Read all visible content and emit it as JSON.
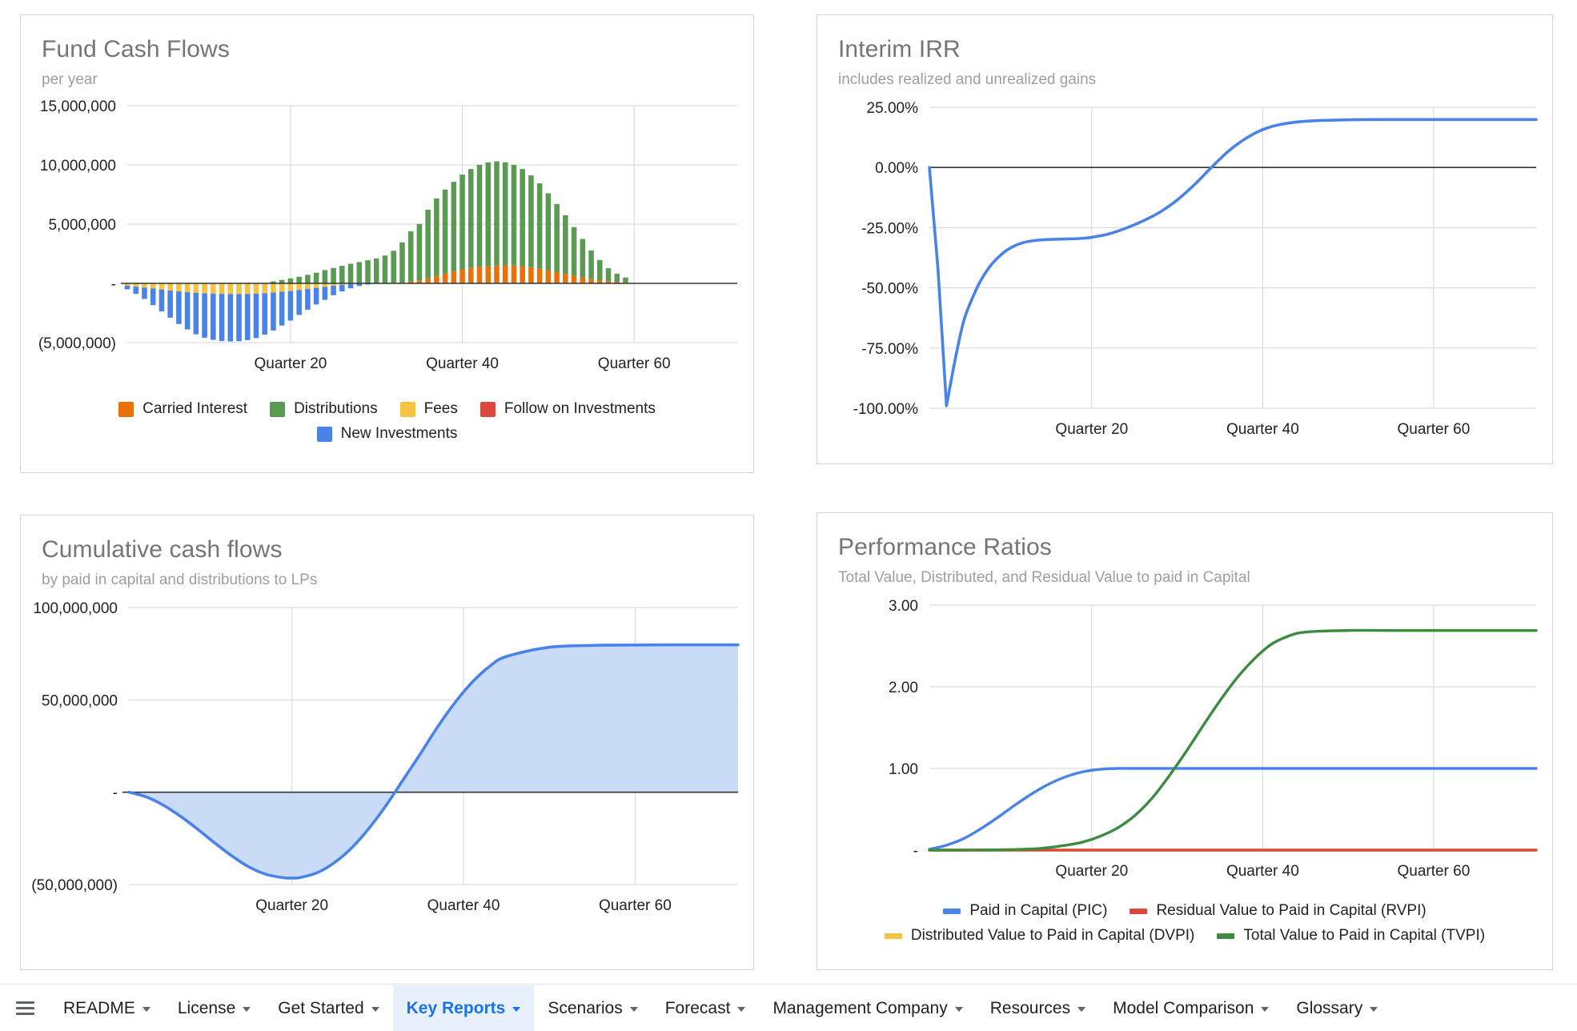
{
  "charts": [
    {
      "id": "fund-cash-flows",
      "title": "Fund Cash Flows",
      "subtitle": "per year",
      "chart_data": {
        "type": "bar",
        "title": "Fund Cash Flows",
        "subtitle": "per year",
        "stacked": true,
        "xlabel": "",
        "ylabel": "",
        "ylim": [
          -5000000,
          15000000
        ],
        "ytick_labels": [
          "15,000,000",
          "10,000,000",
          "5,000,000",
          "-",
          "(5,000,000)"
        ],
        "ytick_values": [
          15000000,
          10000000,
          5000000,
          0,
          -5000000
        ],
        "xtick_labels": [
          "Quarter 20",
          "Quarter 40",
          "Quarter 60"
        ],
        "xtick_values": [
          20,
          40,
          60
        ],
        "x_range": [
          1,
          72
        ],
        "grid": true,
        "legend_position": "bottom",
        "series": [
          {
            "name": "Carried Interest",
            "color": "#e8710a",
            "values": [
              0,
              0,
              0,
              0,
              0,
              0,
              0,
              0,
              0,
              0,
              0,
              0,
              0,
              0,
              0,
              0,
              0,
              0,
              0,
              0,
              0,
              0,
              0,
              0,
              0,
              0,
              0,
              0,
              0,
              0,
              0,
              0,
              60000,
              140000,
              260000,
              420000,
              620000,
              820000,
              1020000,
              1180000,
              1300000,
              1400000,
              1460000,
              1500000,
              1520000,
              1500000,
              1450000,
              1360000,
              1240000,
              1100000,
              950000,
              800000,
              650000,
              500000,
              380000,
              270000,
              180000,
              120000,
              70000,
              0,
              0,
              0,
              0,
              0,
              0,
              0,
              0,
              0,
              0,
              0,
              0,
              0
            ]
          },
          {
            "name": "Distributions",
            "color": "#5b9a53",
            "values": [
              0,
              0,
              0,
              0,
              0,
              0,
              0,
              0,
              0,
              0,
              0,
              0,
              0,
              0,
              0,
              0,
              0,
              170000,
              290000,
              420000,
              560000,
              720000,
              900000,
              1120000,
              1300000,
              1480000,
              1650000,
              1800000,
              1950000,
              2100000,
              2350000,
              2750000,
              3400000,
              4250000,
              4750000,
              5800000,
              6550000,
              7100000,
              7550000,
              8000000,
              8350000,
              8600000,
              8750000,
              8800000,
              8700000,
              8500000,
              8200000,
              7750000,
              7200000,
              6500000,
              5750000,
              4950000,
              4100000,
              3250000,
              2400000,
              1700000,
              1100000,
              700000,
              430000,
              0,
              0,
              0,
              0,
              0,
              0,
              0,
              0,
              0,
              0,
              0,
              0,
              0
            ]
          },
          {
            "name": "Fees",
            "color": "#f5c242",
            "values": [
              -200000,
              -280000,
              -360000,
              -440000,
              -520000,
              -600000,
              -680000,
              -740000,
              -800000,
              -840000,
              -870000,
              -890000,
              -900000,
              -900000,
              -890000,
              -870000,
              -830000,
              -780000,
              -710000,
              -640000,
              -560000,
              -470000,
              -380000,
              -290000,
              -200000,
              -120000,
              -60000,
              -20000,
              0,
              0,
              0,
              0,
              0,
              0,
              0,
              0,
              0,
              0,
              0,
              0,
              0,
              0,
              0,
              0,
              0,
              0,
              0,
              0,
              0,
              0,
              0,
              0,
              0,
              0,
              0,
              0,
              0,
              0,
              0,
              0,
              0,
              0,
              0,
              0,
              0,
              0,
              0,
              0,
              0,
              0,
              0,
              0
            ]
          },
          {
            "name": "Follow on Investments",
            "color": "#d94a3d",
            "values": [
              0,
              0,
              0,
              0,
              0,
              0,
              0,
              0,
              0,
              0,
              0,
              0,
              0,
              0,
              0,
              0,
              0,
              0,
              0,
              0,
              0,
              0,
              0,
              0,
              0,
              0,
              0,
              0,
              0,
              0,
              0,
              0,
              0,
              0,
              0,
              0,
              0,
              0,
              0,
              0,
              0,
              0,
              0,
              0,
              0,
              0,
              0,
              0,
              0,
              0,
              0,
              0,
              0,
              0,
              0,
              0,
              0,
              0,
              0,
              0,
              0,
              0,
              0,
              0,
              0,
              0,
              0,
              0,
              0,
              0,
              0,
              0
            ]
          },
          {
            "name": "New Investments",
            "color": "#4a83e8",
            "values": [
              -300000,
              -600000,
              -950000,
              -1400000,
              -1850000,
              -2300000,
              -2750000,
              -3150000,
              -3500000,
              -3750000,
              -3900000,
              -3980000,
              -4000000,
              -3980000,
              -3900000,
              -3750000,
              -3500000,
              -3200000,
              -2850000,
              -2500000,
              -2100000,
              -1750000,
              -1400000,
              -1100000,
              -800000,
              -560000,
              -360000,
              -200000,
              -100000,
              -40000,
              0,
              0,
              0,
              0,
              0,
              0,
              0,
              0,
              0,
              0,
              0,
              0,
              0,
              0,
              0,
              0,
              0,
              0,
              0,
              0,
              0,
              0,
              0,
              0,
              0,
              0,
              0,
              0,
              0,
              0,
              0,
              0,
              0,
              0,
              0,
              0,
              0,
              0,
              0,
              0,
              0,
              0
            ]
          }
        ]
      },
      "legend": [
        {
          "label": "Carried Interest",
          "color": "#e8710a"
        },
        {
          "label": "Distributions",
          "color": "#5b9a53"
        },
        {
          "label": "Fees",
          "color": "#f5c242"
        },
        {
          "label": "Follow on Investments",
          "color": "#d94a3d"
        },
        {
          "label": "New Investments",
          "color": "#4a83e8"
        }
      ]
    },
    {
      "id": "interim-irr",
      "title": "Interim IRR",
      "subtitle": "includes realized and unrealized gains",
      "chart_data": {
        "type": "line",
        "title": "Interim IRR",
        "subtitle": "includes realized and unrealized gains",
        "xlabel": "",
        "ylabel": "",
        "ylim": [
          -1.0,
          0.25
        ],
        "ytick_labels": [
          "25.00%",
          "0.00%",
          "-25.00%",
          "-50.00%",
          "-75.00%",
          "-100.00%"
        ],
        "ytick_values": [
          0.25,
          0.0,
          -0.25,
          -0.5,
          -0.75,
          -1.0
        ],
        "xtick_labels": [
          "Quarter 20",
          "Quarter 40",
          "Quarter 60"
        ],
        "xtick_values": [
          20,
          40,
          60
        ],
        "x_range": [
          1,
          72
        ],
        "grid": true,
        "legend_position": "none",
        "series": [
          {
            "name": "Interim IRR",
            "color": "#4a83e8",
            "x": [
              1,
              2,
              3,
              4,
              5,
              6,
              7,
              8,
              9,
              10,
              11,
              12,
              13,
              14,
              15,
              16,
              17,
              18,
              19,
              20,
              22,
              24,
              26,
              28,
              30,
              32,
              34,
              36,
              38,
              40,
              42,
              45,
              50,
              55,
              60,
              65,
              72
            ],
            "values": [
              0.0,
              -0.42,
              -0.99,
              -0.8,
              -0.64,
              -0.545,
              -0.47,
              -0.415,
              -0.375,
              -0.345,
              -0.325,
              -0.312,
              -0.305,
              -0.301,
              -0.299,
              -0.298,
              -0.297,
              -0.296,
              -0.294,
              -0.29,
              -0.276,
              -0.252,
              -0.222,
              -0.185,
              -0.135,
              -0.072,
              0.0,
              0.068,
              0.12,
              0.157,
              0.178,
              0.192,
              0.198,
              0.199,
              0.199,
              0.199,
              0.199
            ]
          }
        ]
      },
      "legend": []
    },
    {
      "id": "cumulative-cash-flows",
      "title": "Cumulative cash flows",
      "subtitle": "by paid in capital and distributions to LPs",
      "chart_data": {
        "type": "area",
        "title": "Cumulative cash flows",
        "subtitle": "by paid in capital and distributions to LPs",
        "xlabel": "",
        "ylabel": "",
        "ylim": [
          -50000000,
          100000000
        ],
        "ytick_labels": [
          "100,000,000",
          "50,000,000",
          "-",
          "(50,000,000)"
        ],
        "ytick_values": [
          100000000,
          50000000,
          0,
          -50000000
        ],
        "xtick_labels": [
          "Quarter 20",
          "Quarter 40",
          "Quarter 60"
        ],
        "xtick_values": [
          20,
          40,
          60
        ],
        "x_range": [
          1,
          72
        ],
        "grid": true,
        "legend_position": "none",
        "series": [
          {
            "name": "Cumulative cash flow",
            "color": "#4a83e8",
            "fill": "#c6d9f7",
            "x": [
              1,
              3,
              5,
              7,
              9,
              11,
              13,
              15,
              17,
              19,
              20,
              21,
              23,
              25,
              27,
              29,
              31,
              33,
              35,
              37,
              39,
              41,
              43,
              45,
              50,
              55,
              60,
              65,
              72
            ],
            "values": [
              0,
              -2500000,
              -7000000,
              -13000000,
              -20000000,
              -27500000,
              -34500000,
              -40500000,
              -44500000,
              -46300000,
              -46500000,
              -46200000,
              -43500000,
              -38000000,
              -30000000,
              -19500000,
              -7000000,
              7000000,
              21000000,
              35500000,
              48500000,
              59500000,
              68000000,
              73500000,
              78500000,
              79500000,
              79700000,
              79800000,
              79800000
            ]
          }
        ]
      },
      "legend": []
    },
    {
      "id": "performance-ratios",
      "title": "Performance Ratios",
      "subtitle": "Total Value, Distributed, and Residual Value to paid in Capital",
      "chart_data": {
        "type": "line",
        "title": "Performance Ratios",
        "subtitle": "Total Value, Distributed, and Residual Value to paid in Capital",
        "xlabel": "",
        "ylabel": "",
        "ylim": [
          0,
          3.0
        ],
        "ytick_labels": [
          "3.00",
          "2.00",
          "1.00",
          "-"
        ],
        "ytick_values": [
          3.0,
          2.0,
          1.0,
          0.0
        ],
        "xtick_labels": [
          "Quarter 20",
          "Quarter 40",
          "Quarter 60"
        ],
        "xtick_values": [
          20,
          40,
          60
        ],
        "x_range": [
          1,
          72
        ],
        "grid": true,
        "legend_position": "bottom",
        "series": [
          {
            "name": "Paid in Capital (PIC)",
            "color": "#4a83e8",
            "x": [
              1,
              3,
              5,
              7,
              9,
              11,
              13,
              15,
              17,
              19,
              21,
              23,
              25,
              30,
              40,
              50,
              60,
              72
            ],
            "values": [
              0.01,
              0.06,
              0.14,
              0.26,
              0.4,
              0.55,
              0.69,
              0.81,
              0.9,
              0.96,
              0.99,
              1.0,
              1.0,
              1.0,
              1.0,
              1.0,
              1.0,
              1.0
            ]
          },
          {
            "name": "Residual Value to Paid in Capital (RVPI)",
            "color": "#d94a3d",
            "x": [
              1,
              10,
              20,
              30,
              40,
              50,
              60,
              72
            ],
            "values": [
              0.0,
              0.0,
              0.0,
              0.0,
              0.0,
              0.0,
              0.0,
              0.0
            ]
          },
          {
            "name": "Distributed Value to Paid in Capital (DVPI)",
            "color": "#f5c242",
            "x": [
              1,
              10,
              20,
              30,
              40,
              50,
              60,
              72
            ],
            "values": [
              0.0,
              0.0,
              0.0,
              0.0,
              0.0,
              0.0,
              0.0,
              0.0
            ]
          },
          {
            "name": "Total Value to Paid in Capital (TVPI)",
            "color": "#3d8b40",
            "x": [
              1,
              5,
              10,
              14,
              17,
              19,
              21,
              23,
              25,
              27,
              29,
              31,
              33,
              35,
              37,
              39,
              41,
              43,
              45,
              50,
              55,
              60,
              65,
              72
            ],
            "values": [
              0.0,
              0.0,
              0.005,
              0.02,
              0.06,
              0.1,
              0.17,
              0.27,
              0.42,
              0.63,
              0.9,
              1.2,
              1.52,
              1.83,
              2.11,
              2.34,
              2.52,
              2.62,
              2.67,
              2.69,
              2.69,
              2.69,
              2.69,
              2.69
            ]
          }
        ]
      },
      "legend": [
        {
          "label": "Paid in Capital (PIC)",
          "color": "#4a83e8"
        },
        {
          "label": "Residual Value to Paid in Capital (RVPI)",
          "color": "#d94a3d"
        },
        {
          "label": "Distributed Value to Paid in Capital (DVPI)",
          "color": "#f5c242"
        },
        {
          "label": "Total Value to Paid in Capital (TVPI)",
          "color": "#3d8b40"
        }
      ]
    }
  ],
  "sheet_bar": {
    "menu_icon": "hamburger-icon",
    "tabs": [
      {
        "label": "README",
        "active": false
      },
      {
        "label": "License",
        "active": false
      },
      {
        "label": "Get Started",
        "active": false
      },
      {
        "label": "Key Reports",
        "active": true
      },
      {
        "label": "Scenarios",
        "active": false
      },
      {
        "label": "Forecast",
        "active": false
      },
      {
        "label": "Management Company",
        "active": false
      },
      {
        "label": "Resources",
        "active": false
      },
      {
        "label": "Model Comparison",
        "active": false
      },
      {
        "label": "Glossary",
        "active": false
      }
    ]
  }
}
